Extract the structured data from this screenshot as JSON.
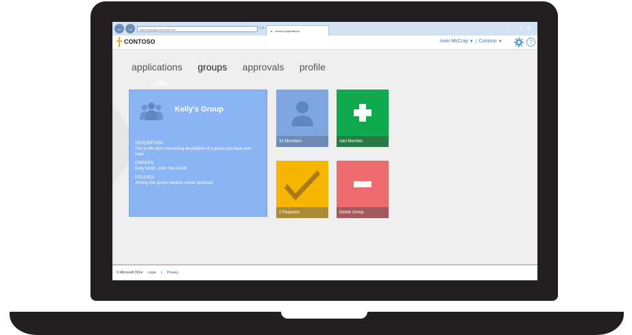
{
  "browser": {
    "url": "https://myapps.microsoft.com",
    "tab_title": "Access Applications"
  },
  "header": {
    "logo": "CONTOSO",
    "user_name": "Irwin McCray",
    "tenant": "Contoso"
  },
  "nav": {
    "items": [
      {
        "label": "applications"
      },
      {
        "label": "groups"
      },
      {
        "label": "approvals"
      },
      {
        "label": "profile"
      }
    ],
    "active": "groups"
  },
  "group": {
    "name": "Kelly's Group",
    "description_label": "DESCRIPTION",
    "description": "This is the most interesting description of a group you have ever read.",
    "owners_label": "OWNERS",
    "owners": "Kelly Smith, John Van Zandt",
    "policies_label": "POLICIES",
    "policies": "Joining this group requires owner approval"
  },
  "tiles": {
    "members": "33 Members",
    "add_member": "Add Member",
    "requests": "2 Requests",
    "delete_group": "Delete Group"
  },
  "footer": {
    "copyright": "© Microsoft 2014",
    "legal": "Legal",
    "separator": "|",
    "privacy": "Privacy"
  },
  "colors": {
    "group_tile": "#8ab4f3",
    "members_tile": "#7fa6de",
    "add_tile": "#10a94e",
    "requests_tile": "#f6b600",
    "delete_tile": "#ee6b6e",
    "accent": "#2a7ab8"
  }
}
